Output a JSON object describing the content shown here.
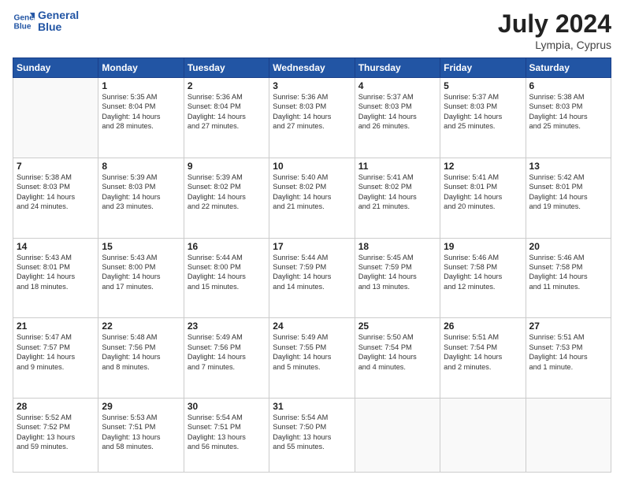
{
  "header": {
    "logo_line1": "General",
    "logo_line2": "Blue",
    "month_year": "July 2024",
    "location": "Lympia, Cyprus"
  },
  "days_of_week": [
    "Sunday",
    "Monday",
    "Tuesday",
    "Wednesday",
    "Thursday",
    "Friday",
    "Saturday"
  ],
  "weeks": [
    [
      {
        "num": "",
        "lines": []
      },
      {
        "num": "1",
        "lines": [
          "Sunrise: 5:35 AM",
          "Sunset: 8:04 PM",
          "Daylight: 14 hours",
          "and 28 minutes."
        ]
      },
      {
        "num": "2",
        "lines": [
          "Sunrise: 5:36 AM",
          "Sunset: 8:04 PM",
          "Daylight: 14 hours",
          "and 27 minutes."
        ]
      },
      {
        "num": "3",
        "lines": [
          "Sunrise: 5:36 AM",
          "Sunset: 8:03 PM",
          "Daylight: 14 hours",
          "and 27 minutes."
        ]
      },
      {
        "num": "4",
        "lines": [
          "Sunrise: 5:37 AM",
          "Sunset: 8:03 PM",
          "Daylight: 14 hours",
          "and 26 minutes."
        ]
      },
      {
        "num": "5",
        "lines": [
          "Sunrise: 5:37 AM",
          "Sunset: 8:03 PM",
          "Daylight: 14 hours",
          "and 25 minutes."
        ]
      },
      {
        "num": "6",
        "lines": [
          "Sunrise: 5:38 AM",
          "Sunset: 8:03 PM",
          "Daylight: 14 hours",
          "and 25 minutes."
        ]
      }
    ],
    [
      {
        "num": "7",
        "lines": [
          "Sunrise: 5:38 AM",
          "Sunset: 8:03 PM",
          "Daylight: 14 hours",
          "and 24 minutes."
        ]
      },
      {
        "num": "8",
        "lines": [
          "Sunrise: 5:39 AM",
          "Sunset: 8:03 PM",
          "Daylight: 14 hours",
          "and 23 minutes."
        ]
      },
      {
        "num": "9",
        "lines": [
          "Sunrise: 5:39 AM",
          "Sunset: 8:02 PM",
          "Daylight: 14 hours",
          "and 22 minutes."
        ]
      },
      {
        "num": "10",
        "lines": [
          "Sunrise: 5:40 AM",
          "Sunset: 8:02 PM",
          "Daylight: 14 hours",
          "and 21 minutes."
        ]
      },
      {
        "num": "11",
        "lines": [
          "Sunrise: 5:41 AM",
          "Sunset: 8:02 PM",
          "Daylight: 14 hours",
          "and 21 minutes."
        ]
      },
      {
        "num": "12",
        "lines": [
          "Sunrise: 5:41 AM",
          "Sunset: 8:01 PM",
          "Daylight: 14 hours",
          "and 20 minutes."
        ]
      },
      {
        "num": "13",
        "lines": [
          "Sunrise: 5:42 AM",
          "Sunset: 8:01 PM",
          "Daylight: 14 hours",
          "and 19 minutes."
        ]
      }
    ],
    [
      {
        "num": "14",
        "lines": [
          "Sunrise: 5:43 AM",
          "Sunset: 8:01 PM",
          "Daylight: 14 hours",
          "and 18 minutes."
        ]
      },
      {
        "num": "15",
        "lines": [
          "Sunrise: 5:43 AM",
          "Sunset: 8:00 PM",
          "Daylight: 14 hours",
          "and 17 minutes."
        ]
      },
      {
        "num": "16",
        "lines": [
          "Sunrise: 5:44 AM",
          "Sunset: 8:00 PM",
          "Daylight: 14 hours",
          "and 15 minutes."
        ]
      },
      {
        "num": "17",
        "lines": [
          "Sunrise: 5:44 AM",
          "Sunset: 7:59 PM",
          "Daylight: 14 hours",
          "and 14 minutes."
        ]
      },
      {
        "num": "18",
        "lines": [
          "Sunrise: 5:45 AM",
          "Sunset: 7:59 PM",
          "Daylight: 14 hours",
          "and 13 minutes."
        ]
      },
      {
        "num": "19",
        "lines": [
          "Sunrise: 5:46 AM",
          "Sunset: 7:58 PM",
          "Daylight: 14 hours",
          "and 12 minutes."
        ]
      },
      {
        "num": "20",
        "lines": [
          "Sunrise: 5:46 AM",
          "Sunset: 7:58 PM",
          "Daylight: 14 hours",
          "and 11 minutes."
        ]
      }
    ],
    [
      {
        "num": "21",
        "lines": [
          "Sunrise: 5:47 AM",
          "Sunset: 7:57 PM",
          "Daylight: 14 hours",
          "and 9 minutes."
        ]
      },
      {
        "num": "22",
        "lines": [
          "Sunrise: 5:48 AM",
          "Sunset: 7:56 PM",
          "Daylight: 14 hours",
          "and 8 minutes."
        ]
      },
      {
        "num": "23",
        "lines": [
          "Sunrise: 5:49 AM",
          "Sunset: 7:56 PM",
          "Daylight: 14 hours",
          "and 7 minutes."
        ]
      },
      {
        "num": "24",
        "lines": [
          "Sunrise: 5:49 AM",
          "Sunset: 7:55 PM",
          "Daylight: 14 hours",
          "and 5 minutes."
        ]
      },
      {
        "num": "25",
        "lines": [
          "Sunrise: 5:50 AM",
          "Sunset: 7:54 PM",
          "Daylight: 14 hours",
          "and 4 minutes."
        ]
      },
      {
        "num": "26",
        "lines": [
          "Sunrise: 5:51 AM",
          "Sunset: 7:54 PM",
          "Daylight: 14 hours",
          "and 2 minutes."
        ]
      },
      {
        "num": "27",
        "lines": [
          "Sunrise: 5:51 AM",
          "Sunset: 7:53 PM",
          "Daylight: 14 hours",
          "and 1 minute."
        ]
      }
    ],
    [
      {
        "num": "28",
        "lines": [
          "Sunrise: 5:52 AM",
          "Sunset: 7:52 PM",
          "Daylight: 13 hours",
          "and 59 minutes."
        ]
      },
      {
        "num": "29",
        "lines": [
          "Sunrise: 5:53 AM",
          "Sunset: 7:51 PM",
          "Daylight: 13 hours",
          "and 58 minutes."
        ]
      },
      {
        "num": "30",
        "lines": [
          "Sunrise: 5:54 AM",
          "Sunset: 7:51 PM",
          "Daylight: 13 hours",
          "and 56 minutes."
        ]
      },
      {
        "num": "31",
        "lines": [
          "Sunrise: 5:54 AM",
          "Sunset: 7:50 PM",
          "Daylight: 13 hours",
          "and 55 minutes."
        ]
      },
      {
        "num": "",
        "lines": []
      },
      {
        "num": "",
        "lines": []
      },
      {
        "num": "",
        "lines": []
      }
    ]
  ]
}
